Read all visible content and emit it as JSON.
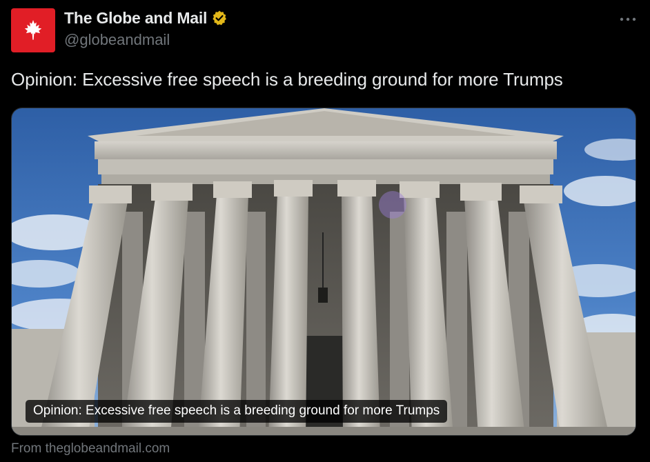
{
  "author": {
    "display_name": "The Globe and Mail",
    "handle": "@globeandmail",
    "verified": true,
    "avatar_icon": "maple-leaf-icon",
    "avatar_color": "#e11e26",
    "badge_color": "#e2b719"
  },
  "menu": {
    "icon": "more-horizontal-icon"
  },
  "tweet": {
    "text": "Opinion: Excessive free speech is a breeding ground for more Trumps"
  },
  "card": {
    "title": "Opinion: Excessive free speech is a breeding ground for more Trumps",
    "source": "From theglobeandmail.com",
    "image_description_icon": "supreme-court-photo"
  },
  "colors": {
    "background": "#000000",
    "primary_text": "#e7e9ea",
    "secondary_text": "#71767b",
    "border": "#2f3336"
  }
}
